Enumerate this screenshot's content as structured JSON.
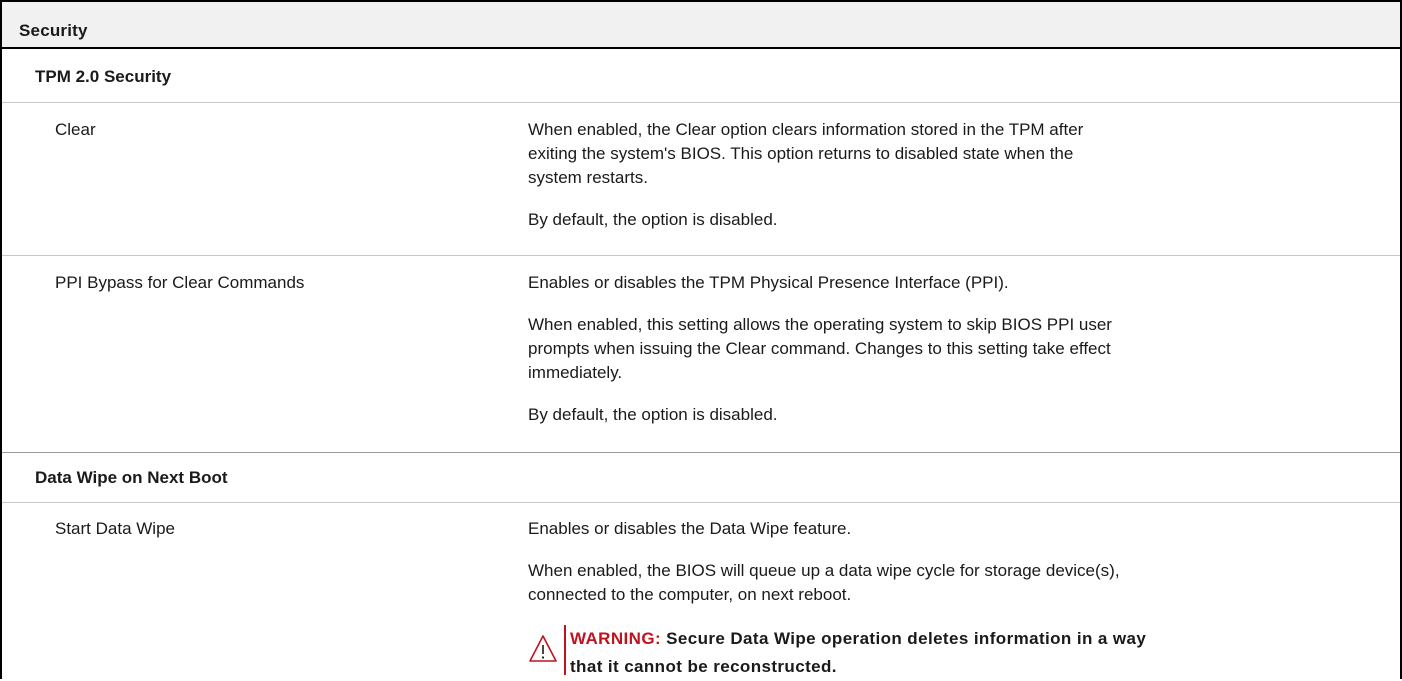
{
  "header": {
    "title": "Security"
  },
  "sections": [
    {
      "title": "TPM 2.0 Security",
      "items": [
        {
          "label": "Clear",
          "desc": [
            "When enabled, the Clear option clears information stored in the TPM after",
            "exiting the system's BIOS. This option returns to disabled state when the",
            "system restarts.",
            "By default, the option is disabled."
          ]
        },
        {
          "label": "PPI Bypass for Clear Commands",
          "desc": [
            "Enables or disables the TPM Physical Presence Interface (PPI).",
            "When enabled, this setting allows the operating system to skip BIOS PPI user",
            "prompts when issuing the Clear command. Changes to this setting take effect",
            "immediately.",
            "By default, the option is disabled."
          ]
        }
      ]
    },
    {
      "title": "Data Wipe on Next Boot",
      "items": [
        {
          "label": "Start Data Wipe",
          "desc": [
            "Enables or disables the Data Wipe feature.",
            "When enabled, the BIOS will queue up a data wipe cycle for storage device(s),",
            "connected to the computer, on next reboot."
          ],
          "warning": {
            "label": "WARNING:",
            "line1": "Secure Data Wipe operation deletes information in a way",
            "line2": "that it cannot be reconstructed."
          }
        }
      ]
    }
  ],
  "colors": {
    "warning": "#c1121f",
    "header_bg": "#f1f1f1"
  },
  "icons": {
    "warning": "warning-triangle-icon"
  }
}
